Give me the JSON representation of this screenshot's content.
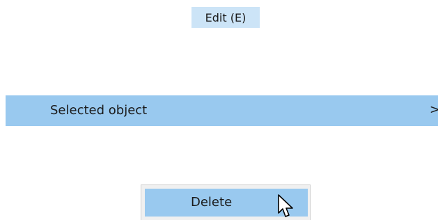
{
  "menubar": {
    "edit_label": "Edit (E)"
  },
  "submenu": {
    "selected_object_label": "Selected object",
    "arrow_glyph": ">"
  },
  "context_menu": {
    "delete_label": "Delete"
  },
  "icons": {
    "submenu_arrow": "chevron-right-icon",
    "cursor": "arrow-pointer-icon"
  },
  "colors": {
    "edit_highlight": "#cce4f7",
    "item_highlight": "#99c9ef",
    "menu_background": "#f0f0f0"
  }
}
